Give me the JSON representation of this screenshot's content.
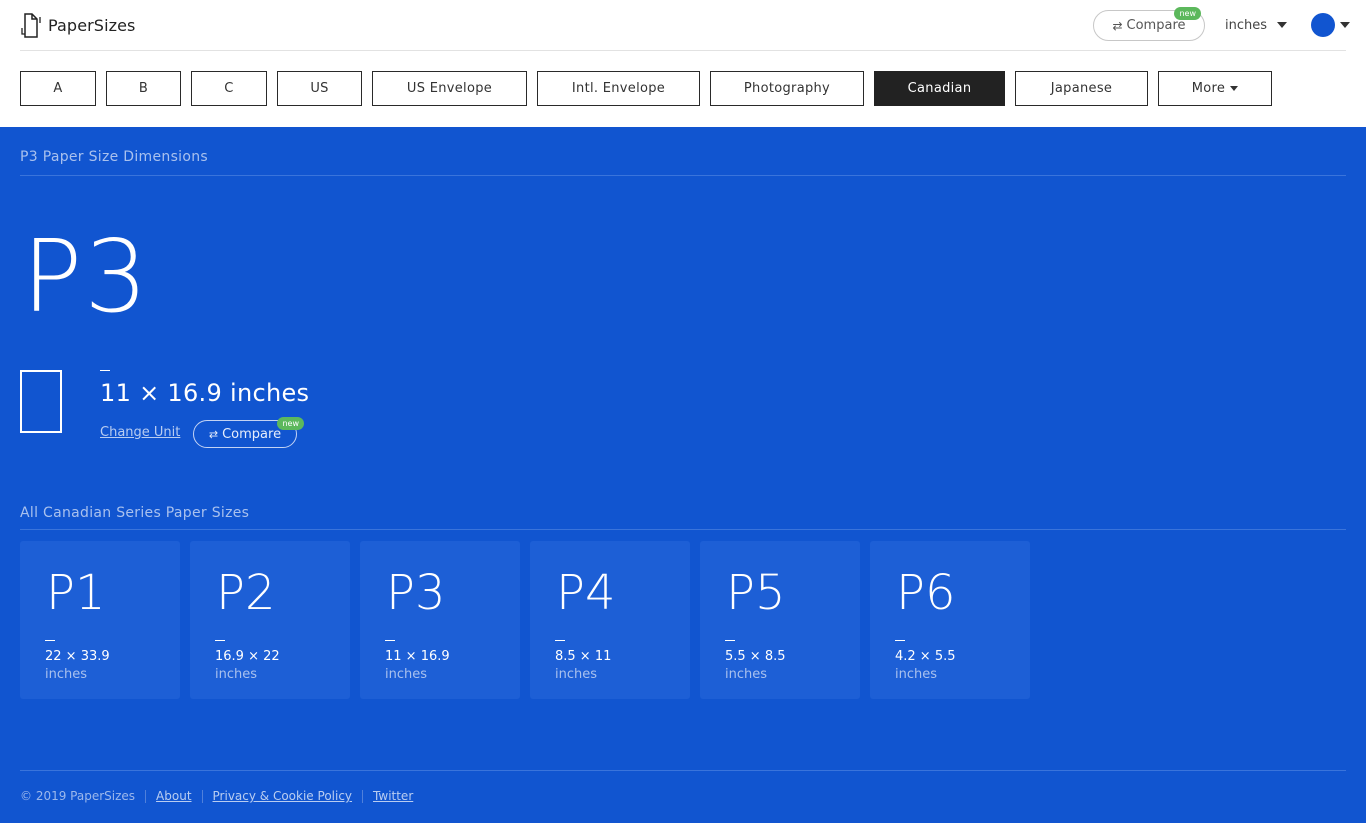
{
  "app": {
    "name": "PaperSizes"
  },
  "header": {
    "compare_label": "Compare",
    "compare_badge": "new",
    "unit_label": "inches",
    "theme_color": "#1155d0"
  },
  "tabs": [
    {
      "label": "A",
      "active": false
    },
    {
      "label": "B",
      "active": false
    },
    {
      "label": "C",
      "active": false
    },
    {
      "label": "US",
      "active": false
    },
    {
      "label": "US Envelope",
      "active": false
    },
    {
      "label": "Intl. Envelope",
      "active": false
    },
    {
      "label": "Photography",
      "active": false
    },
    {
      "label": "Canadian",
      "active": true
    },
    {
      "label": "Japanese",
      "active": false
    },
    {
      "label": "More",
      "active": false
    }
  ],
  "main": {
    "section_title": "P3 Paper Size Dimensions",
    "size_name": "P3",
    "dimensions": "11 × 16.9 inches",
    "change_unit_label": "Change Unit",
    "compare_label": "Compare",
    "compare_badge": "new"
  },
  "series": {
    "title": "All Canadian Series Paper Sizes",
    "items": [
      {
        "name": "P1",
        "dims": "22 × 33.9",
        "unit": "inches"
      },
      {
        "name": "P2",
        "dims": "16.9 × 22",
        "unit": "inches"
      },
      {
        "name": "P3",
        "dims": "11 × 16.9",
        "unit": "inches"
      },
      {
        "name": "P4",
        "dims": "8.5 × 11",
        "unit": "inches"
      },
      {
        "name": "P5",
        "dims": "5.5 × 8.5",
        "unit": "inches"
      },
      {
        "name": "P6",
        "dims": "4.2 × 5.5",
        "unit": "inches"
      }
    ]
  },
  "footer": {
    "copyright": "© 2019 PaperSizes",
    "links": [
      "About",
      "Privacy & Cookie Policy",
      "Twitter"
    ]
  },
  "colors": {
    "background": "#1155d0",
    "card": "#1d5fd6",
    "active_tab": "#222222",
    "badge": "#5cb85c"
  },
  "icons": {
    "logo": "paper-rotate-icon",
    "compare": "swap-arrows-icon",
    "dropdown": "caret-down-icon"
  }
}
